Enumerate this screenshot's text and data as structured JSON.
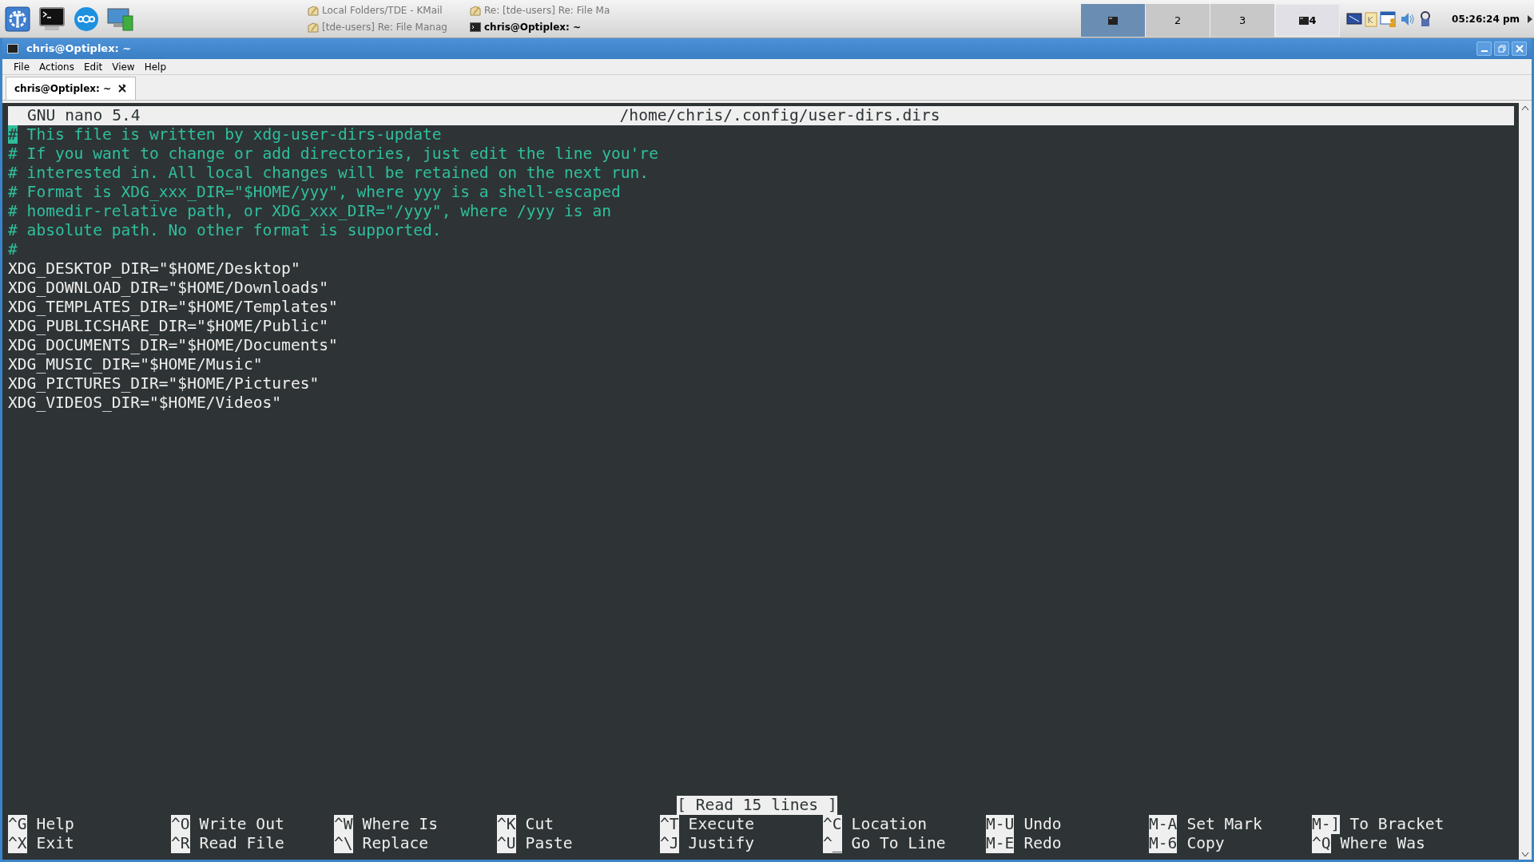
{
  "taskbar": {
    "tasks": [
      {
        "label": "Local Folders/TDE - KMail",
        "active": false,
        "kind": "mail"
      },
      {
        "label": "Re: [tde-users] Re: File Ma",
        "active": false,
        "kind": "mail"
      },
      {
        "label": "[tde-users] Re: File Manag",
        "active": false,
        "kind": "mail"
      },
      {
        "label": "chris@Optiplex: ~",
        "active": true,
        "kind": "terminal"
      }
    ],
    "desktops": [
      {
        "selected": true,
        "kind": "thumbnail"
      },
      {
        "label": "2",
        "selected": false,
        "kind": "number"
      },
      {
        "label": "3",
        "selected": false,
        "kind": "number"
      },
      {
        "label": "4",
        "selected": false,
        "kind": "thumbnail"
      }
    ],
    "clock": "05:26:24 pm"
  },
  "window": {
    "title": "chris@Optiplex: ~",
    "menu": [
      "File",
      "Actions",
      "Edit",
      "View",
      "Help"
    ],
    "tabs": [
      {
        "label": "chris@Optiplex: ~",
        "selected": true
      }
    ]
  },
  "nano": {
    "version": "GNU nano 5.4",
    "path": "/home/chris/.config/user-dirs.dirs",
    "lines": [
      {
        "text": "# This file is written by xdg-user-dirs-update",
        "kind": "comment",
        "cursor": true
      },
      {
        "text": "# If you want to change or add directories, just edit the line you're",
        "kind": "comment",
        "cursor": false
      },
      {
        "text": "# interested in. All local changes will be retained on the next run.",
        "kind": "comment",
        "cursor": false
      },
      {
        "text": "# Format is XDG_xxx_DIR=\"$HOME/yyy\", where yyy is a shell-escaped",
        "kind": "comment",
        "cursor": false
      },
      {
        "text": "# homedir-relative path, or XDG_xxx_DIR=\"/yyy\", where /yyy is an",
        "kind": "comment",
        "cursor": false
      },
      {
        "text": "# absolute path. No other format is supported.",
        "kind": "comment",
        "cursor": false
      },
      {
        "text": "#",
        "kind": "comment",
        "cursor": false
      },
      {
        "text": "XDG_DESKTOP_DIR=\"$HOME/Desktop\"",
        "kind": "plain",
        "cursor": false
      },
      {
        "text": "XDG_DOWNLOAD_DIR=\"$HOME/Downloads\"",
        "kind": "plain",
        "cursor": false
      },
      {
        "text": "XDG_TEMPLATES_DIR=\"$HOME/Templates\"",
        "kind": "plain",
        "cursor": false
      },
      {
        "text": "XDG_PUBLICSHARE_DIR=\"$HOME/Public\"",
        "kind": "plain",
        "cursor": false
      },
      {
        "text": "XDG_DOCUMENTS_DIR=\"$HOME/Documents\"",
        "kind": "plain",
        "cursor": false
      },
      {
        "text": "XDG_MUSIC_DIR=\"$HOME/Music\"",
        "kind": "plain",
        "cursor": false
      },
      {
        "text": "XDG_PICTURES_DIR=\"$HOME/Pictures\"",
        "kind": "plain",
        "cursor": false
      },
      {
        "text": "XDG_VIDEOS_DIR=\"$HOME/Videos\"",
        "kind": "plain",
        "cursor": false
      }
    ],
    "status": "[ Read 15 lines ]",
    "shortcut_rows": [
      [
        {
          "key": "^G",
          "label": "Help"
        },
        {
          "key": "^O",
          "label": "Write Out"
        },
        {
          "key": "^W",
          "label": "Where Is"
        },
        {
          "key": "^K",
          "label": "Cut"
        },
        {
          "key": "^T",
          "label": "Execute"
        },
        {
          "key": "^C",
          "label": "Location"
        },
        {
          "key": "M-U",
          "label": "Undo"
        },
        {
          "key": "M-A",
          "label": "Set Mark"
        },
        {
          "key": "M-]",
          "label": "To Bracket"
        }
      ],
      [
        {
          "key": "^X",
          "label": "Exit"
        },
        {
          "key": "^R",
          "label": "Read File"
        },
        {
          "key": "^\\",
          "label": "Replace"
        },
        {
          "key": "^U",
          "label": "Paste"
        },
        {
          "key": "^J",
          "label": "Justify"
        },
        {
          "key": "^_",
          "label": "Go To Line"
        },
        {
          "key": "M-E",
          "label": "Redo"
        },
        {
          "key": "M-6",
          "label": "Copy"
        },
        {
          "key": "^Q",
          "label": "Where Was"
        }
      ]
    ]
  }
}
